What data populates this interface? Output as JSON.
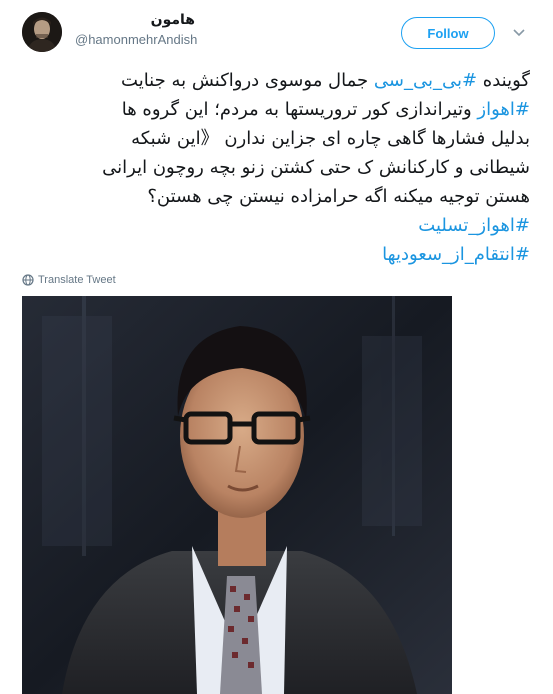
{
  "user": {
    "display_name": "هامون",
    "handle": "@hamonmehrAndish",
    "avatar_icon": "user-avatar"
  },
  "header": {
    "follow_label": "Follow",
    "menu_icon": "chevron-down-icon"
  },
  "tweet": {
    "line1_text": "گوینده ",
    "line1_tag": "#بی_بی_سی",
    "line1_rest": " جمال موسوی درواکنش به جنایت",
    "line2_tag": "#اهواز",
    "line2_rest": " وتیراندازی کور تروریستها به مردم؛ این گروه ها",
    "line3": "بدلیل فشارها گاهی چاره ای جزاین ندارن 《این شبکه",
    "line4": "شیطانی و کارکنانش ک حتی کشتن زنو بچه روچون ایرانی",
    "line5": "هستن توجیه میکنه اگه حرامزاده نیستن چی هستن؟",
    "hashtag1": "#اهواز_تسلیت",
    "hashtag2": "#انتقام_از_سعودیها"
  },
  "translate": {
    "label": "Translate Tweet",
    "icon": "globe-icon"
  },
  "colors": {
    "link": "#1b95e0",
    "follow": "#1da1f2",
    "secondary_text": "#657786",
    "primary_text": "#14171a"
  }
}
